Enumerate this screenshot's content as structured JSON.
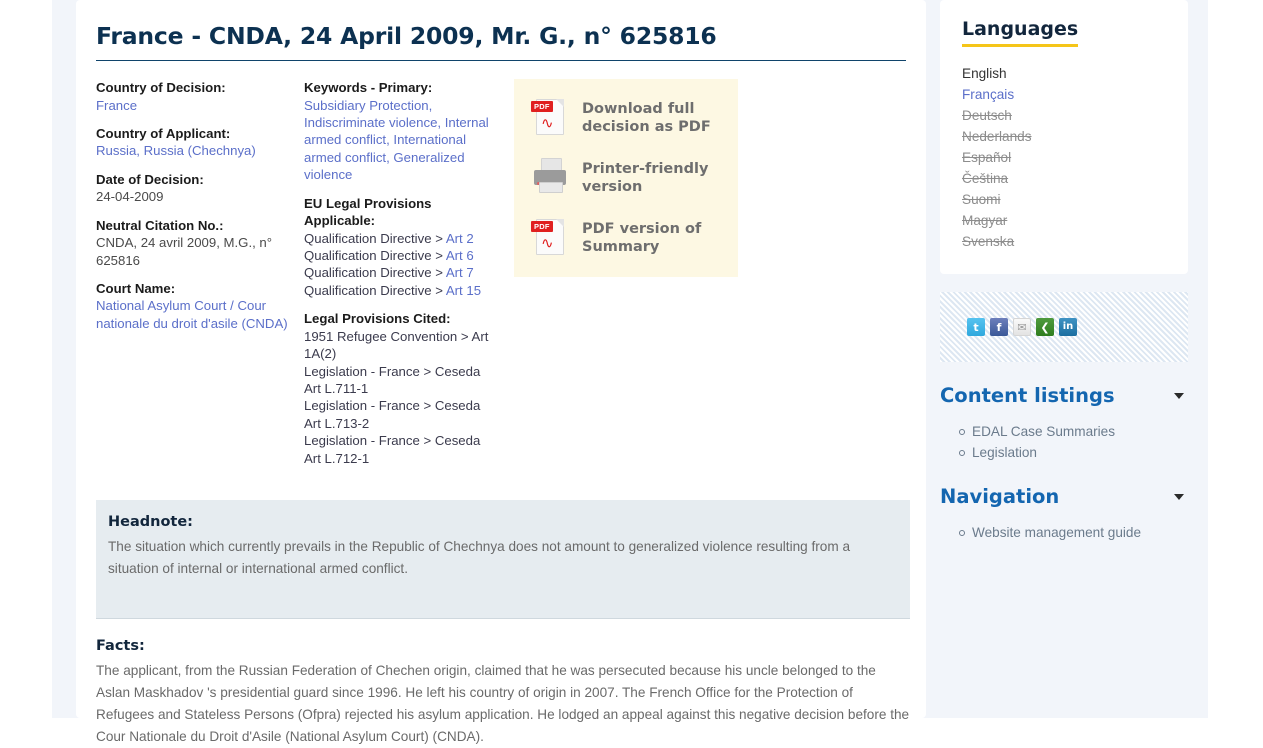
{
  "case": {
    "title": "France - CNDA, 24 April 2009, Mr. G., n° 625816",
    "fields": [
      {
        "label": "Country of Decision:",
        "value": "France",
        "link": true
      },
      {
        "label": "Country of Applicant:",
        "value": "Russia, Russia (Chechnya)",
        "link": true
      },
      {
        "label": "Date of Decision:",
        "value": "24-04-2009",
        "link": false
      },
      {
        "label": "Neutral Citation No.:",
        "value": "CNDA, 24 avril 2009, M.G., n° 625816",
        "link": false
      },
      {
        "label": "Court Name:",
        "value": "National Asylum Court / Cour nationale du droit d'asile (CNDA)",
        "link": true
      }
    ],
    "keywords_label": "Keywords - Primary:",
    "keywords": "Subsidiary Protection, Indiscriminate violence, Internal armed conflict, International armed conflict, Generalized violence",
    "eu_provisions_label": "EU Legal Provisions Applicable:",
    "eu_provisions": [
      {
        "source": "Qualification Directive > ",
        "article": "Art 2"
      },
      {
        "source": "Qualification Directive > ",
        "article": "Art 6"
      },
      {
        "source": "Qualification Directive > ",
        "article": "Art 7"
      },
      {
        "source": "Qualification Directive > ",
        "article": "Art 15"
      }
    ],
    "cited_label": "Legal Provisions Cited:",
    "cited": [
      "1951 Refugee Convention > Art 1A(2)",
      "Legislation - France > Ceseda Art L.711-1",
      "Legislation - France > Ceseda Art L.713-2",
      "Legislation - France > Ceseda Art L.712-1"
    ],
    "headnote_label": "Headnote:",
    "headnote_body": "The situation which currently prevails in the Republic of Chechnya does not amount to generalized violence resulting from a situation of internal or international armed conflict.",
    "facts_label": "Facts:",
    "facts_body": "The applicant, from the Russian Federation of Chechen origin, claimed that he was persecuted because his uncle belonged to the Aslan Maskhadov 's  presidential guard since 1996. He left his country of origin in 2007. The French Office for the Protection of Refugees and Stateless Persons (Ofpra) rejected his asylum application. He lodged an appeal against this negative decision before the Cour Nationale du Droit d'Asile (National Asylum Court) (CNDA)."
  },
  "downloads": {
    "items": [
      {
        "icon": "pdf-icon",
        "label": "Download full decision as PDF"
      },
      {
        "icon": "printer-icon",
        "label": "Printer-friendly version"
      },
      {
        "icon": "pdf-icon",
        "label": "PDF version of Summary"
      }
    ]
  },
  "sidebar": {
    "languages_title": "Languages",
    "languages": [
      {
        "label": "English",
        "state": "current"
      },
      {
        "label": "Français",
        "state": "available"
      },
      {
        "label": "Deutsch",
        "state": "unavailable"
      },
      {
        "label": "Nederlands",
        "state": "unavailable"
      },
      {
        "label": "Español",
        "state": "unavailable"
      },
      {
        "label": "Čeština",
        "state": "unavailable"
      },
      {
        "label": "Suomi",
        "state": "unavailable"
      },
      {
        "label": "Magyar",
        "state": "unavailable"
      },
      {
        "label": "Svenska",
        "state": "unavailable"
      }
    ],
    "share": [
      {
        "name": "twitter-icon",
        "glyph": "t"
      },
      {
        "name": "facebook-icon",
        "glyph": "f"
      },
      {
        "name": "email-icon",
        "glyph": "✉"
      },
      {
        "name": "share-icon",
        "glyph": "❮"
      },
      {
        "name": "linkedin-icon",
        "glyph": "in"
      }
    ],
    "content_listings": {
      "title": "Content listings",
      "items": [
        "EDAL Case Summaries",
        "Legislation"
      ]
    },
    "navigation": {
      "title": "Navigation",
      "items": [
        "Website management guide"
      ]
    }
  },
  "colors": {
    "accent_yellow": "#f5c518",
    "link_blue": "#5b6fc9",
    "heading_blue": "#1466b0",
    "title_navy": "#0c3151",
    "download_bg": "#fdf8e3",
    "headnote_bg": "#e6ecf0",
    "page_bg": "#f2f5fa"
  }
}
